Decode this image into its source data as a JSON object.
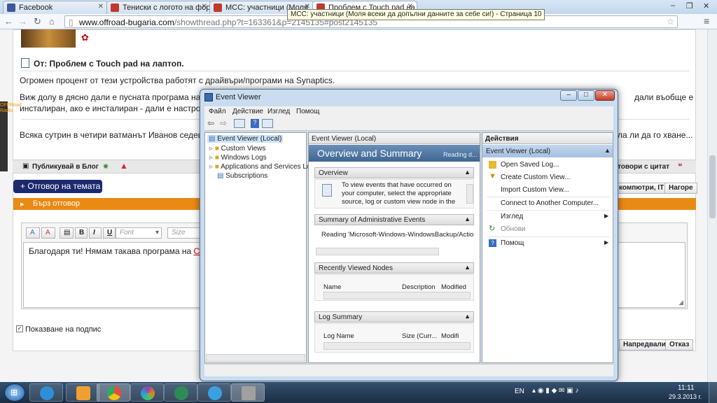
{
  "browser": {
    "tabs": [
      {
        "label": "Facebook",
        "color": "#3b5998"
      },
      {
        "label": "Тениски с логото на фор",
        "color": "#c0392b"
      },
      {
        "label": "MCC: участници (Моля",
        "color": "#c0392b"
      },
      {
        "label": "Проблем с Touch pad на",
        "color": "#c0392b"
      }
    ],
    "tooltip": "MCC: участници (Моля всеки да допълни данните за себе си!) - Страница 10",
    "window_controls": [
      "–",
      "❐",
      "✕"
    ],
    "url_host": "www.offroad-bugaria.com",
    "url_path": "/showthread.php?t=163361&p=2145135#post2145135"
  },
  "forum": {
    "post_title": "От: Проблем с Touch pad на лаптоп.",
    "p1": "Огромен процент от тези устройства работят с драйвъри/програми на Synaptics.",
    "p2a": "Виж долу в дясно дали е пусната програма на Си",
    "p2b": "инсталиран, ако е инсталиран - дали е настроен",
    "p2c": "дали въобще е",
    "p3": "Всяка сутрин в четири ватманът Иванов седеше в",
    "p3b": "ла ли да го хване...",
    "radio_label": "OFFRoad Radio",
    "blog_btn": "Публикувай в Блог",
    "quote_btn": "товори с цитат",
    "reply_topic": "+ Отговор на темата",
    "topic_btns": [
      "компютри, IT",
      "Нагоре"
    ],
    "quick_reply": "Бърз отговор",
    "font_placeholder": "Font",
    "size_placeholder": "Size",
    "editor_text": "Благодаря ти! Нямам такава програма на ",
    "editor_text_link": "Синап",
    "signature_label": "Показване на подпис",
    "adv_btn": "Напредвали",
    "cancel_btn": "Отказ"
  },
  "event_viewer": {
    "title": "Event Viewer",
    "menu": [
      "Файл",
      "Действие",
      "Изглед",
      "Помощ"
    ],
    "tree": [
      "Event Viewer (Local)",
      "Custom Views",
      "Windows Logs",
      "Applications and Services Lo",
      "Subscriptions"
    ],
    "mid_header": "Event Viewer (Local)",
    "overview_title": "Overview and Summary",
    "reading": "Reading d...",
    "sec_overview": "Overview",
    "overview_text": [
      "To view events that have occurred on",
      "your computer, select the appropriate",
      "source, log or custom view node in the"
    ],
    "sec_admin": "Summary of Administrative Events",
    "admin_reading": "Reading 'Microsoft-Windows-WindowsBackup/ActionC",
    "sec_recent": "Recently Viewed Nodes",
    "recent_cols": [
      "Name",
      "Description",
      "Modified"
    ],
    "sec_log": "Log Summary",
    "log_cols": [
      "Log Name",
      "Size (Curr...",
      "Modifi"
    ],
    "actions_title": "Действия",
    "actions_group": "Event Viewer (Local)",
    "actions": [
      "Open Saved Log...",
      "Create Custom View...",
      "Import Custom View...",
      "Connect to Another Computer...",
      "Изглед",
      "Обнови",
      "Помощ"
    ]
  },
  "taskbar": {
    "lang": "EN",
    "time": "11:11",
    "date": "29.3.2013 г.",
    "apps": [
      "#2f8fd6",
      "#f0a030",
      "#e74c3c",
      "#8e44ad",
      "#2e8b57",
      "#3aa0e0",
      "#a0a0a0"
    ]
  }
}
